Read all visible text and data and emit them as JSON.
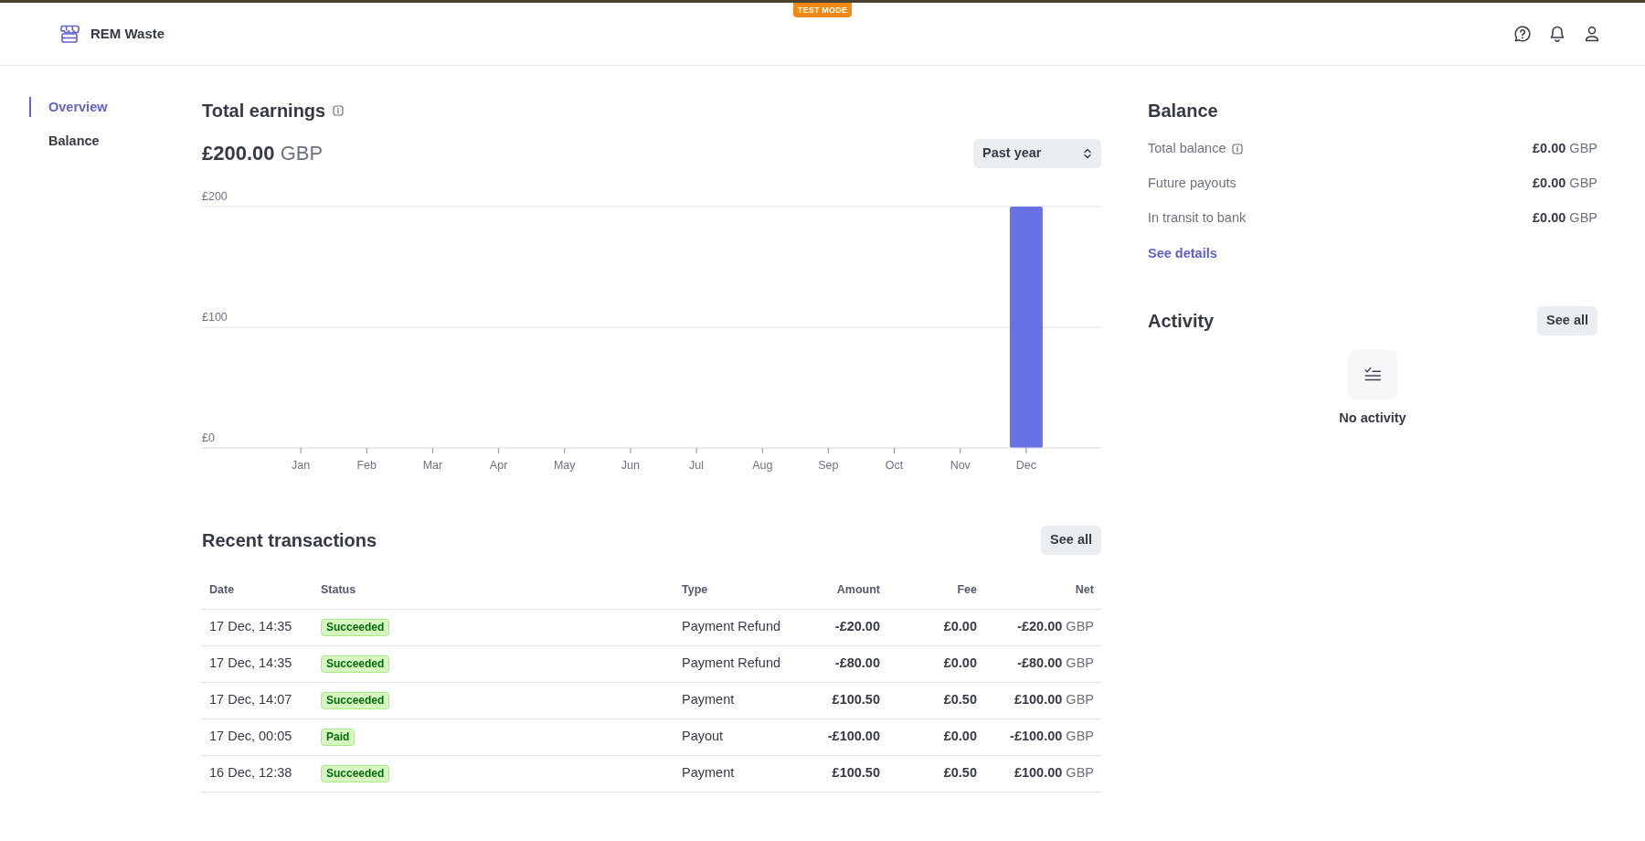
{
  "top_banner": {
    "label": "TEST MODE"
  },
  "header": {
    "brand": "REM Waste"
  },
  "sidebar": {
    "items": [
      {
        "label": "Overview",
        "selected": true
      },
      {
        "label": "Balance",
        "selected": false
      }
    ]
  },
  "earnings": {
    "title": "Total earnings",
    "total": "**£200.00** GBP",
    "period": "Past year",
    "chart_data": {
      "type": "bar",
      "categories": [
        "Jan",
        "Feb",
        "Mar",
        "Apr",
        "May",
        "Jun",
        "Jul",
        "Aug",
        "Sep",
        "Oct",
        "Nov",
        "Dec"
      ],
      "values": [
        0,
        0,
        0,
        0,
        0,
        0,
        0,
        0,
        0,
        0,
        0,
        200
      ],
      "ylim": [
        0,
        200
      ],
      "yticks": [
        {
          "value": 0,
          "label": "£0"
        },
        {
          "value": 100,
          "label": "£100"
        },
        {
          "value": 200,
          "label": "£200"
        }
      ]
    }
  },
  "transactions": {
    "title": "Recent transactions",
    "see_all": "See all",
    "columns": [
      "Date",
      "Status",
      "Type",
      "Amount",
      "Fee",
      "Net"
    ],
    "rows": [
      {
        "date": "17 Dec, 14:35",
        "status": "Succeeded",
        "type": "Payment Refund",
        "amount": "-£20.00",
        "fee": "£0.00",
        "net": "**-£20.00** GBP"
      },
      {
        "date": "17 Dec, 14:35",
        "status": "Succeeded",
        "type": "Payment Refund",
        "amount": "-£80.00",
        "fee": "£0.00",
        "net": "**-£80.00** GBP"
      },
      {
        "date": "17 Dec, 14:07",
        "status": "Succeeded",
        "type": "Payment",
        "amount": "£100.50",
        "fee": "£0.50",
        "net": "**£100.00** GBP"
      },
      {
        "date": "17 Dec, 00:05",
        "status": "Paid",
        "type": "Payout",
        "amount": "-£100.00",
        "fee": "£0.00",
        "net": "**-£100.00** GBP"
      },
      {
        "date": "16 Dec, 12:38",
        "status": "Succeeded",
        "type": "Payment",
        "amount": "£100.50",
        "fee": "£0.50",
        "net": "**£100.00** GBP"
      }
    ]
  },
  "balance": {
    "title": "Balance",
    "rows": [
      {
        "label": "Total balance",
        "info": true,
        "value": "**£0.00** GBP"
      },
      {
        "label": "Future payouts",
        "info": false,
        "value": "**£0.00** GBP"
      },
      {
        "label": "In transit to bank",
        "info": false,
        "value": "**£0.00** GBP"
      }
    ],
    "link": "See details"
  },
  "activity": {
    "title": "Activity",
    "see_all": "See all",
    "empty": "No activity"
  }
}
